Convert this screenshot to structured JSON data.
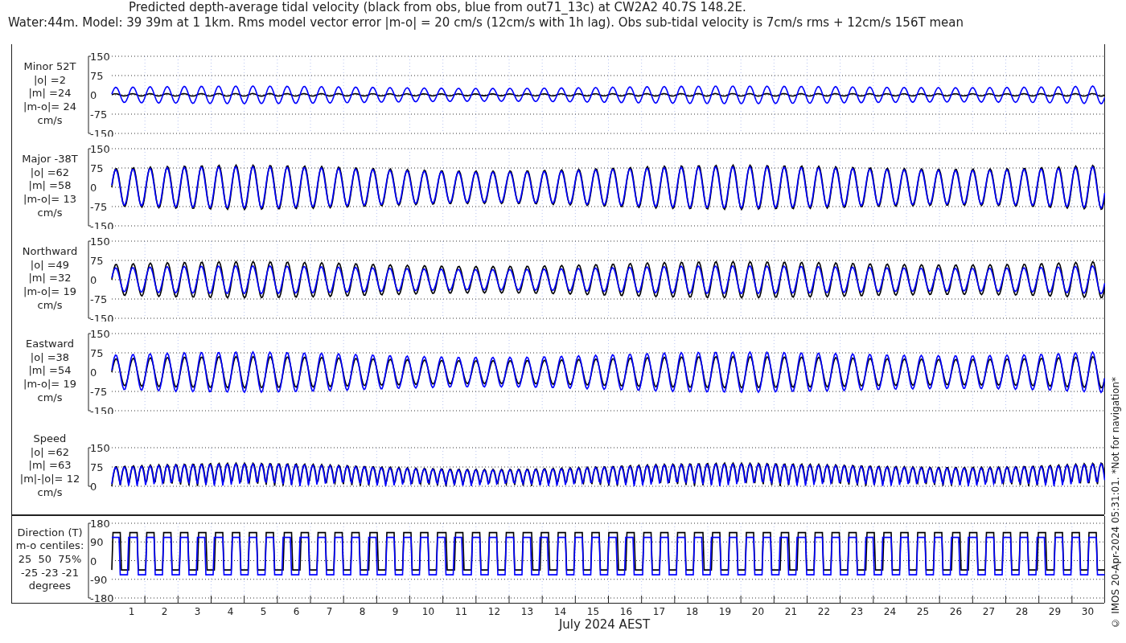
{
  "title": [
    "Predicted depth-average tidal velocity (black from obs, blue from out71_13c) at CW2A2 40.7S 148.2E.",
    "Water:44m. Model: 39 39m at 1 1km. Rms model vector error |m-o| = 20 cm/s (12cm/s with 1h lag). Obs sub-tidal velocity is 7cm/s rms + 12cm/s 156T mean"
  ],
  "panels": [
    {
      "kind": "velocity",
      "label": [
        "Minor 52T",
        "|o| =2",
        "|m| =24",
        "|m-o|= 24",
        "cm/s"
      ],
      "yticks": [
        "150",
        "75",
        "0",
        "-75",
        "-150"
      ]
    },
    {
      "kind": "velocity",
      "label": [
        "Major -38T",
        "|o| =62",
        "|m| =58",
        "|m-o|= 13",
        "cm/s"
      ],
      "yticks": [
        "150",
        "75",
        "0",
        "-75",
        "-150"
      ]
    },
    {
      "kind": "velocity",
      "label": [
        "Northward",
        "|o| =49",
        "|m| =32",
        "|m-o|= 19",
        "cm/s"
      ],
      "yticks": [
        "150",
        "75",
        "0",
        "-75",
        "-150"
      ]
    },
    {
      "kind": "velocity",
      "label": [
        "Eastward",
        "|o| =38",
        "|m| =54",
        "|m-o|= 19",
        "cm/s"
      ],
      "yticks": [
        "150",
        "75",
        "0",
        "-75",
        "-150"
      ]
    },
    {
      "kind": "speed",
      "label": [
        "Speed",
        "|o| =62",
        "|m| =63",
        "|m|-|o|= 12",
        "cm/s"
      ],
      "yticks": [
        "150",
        "75",
        "0"
      ]
    },
    {
      "kind": "direction",
      "label": [
        "Direction (T)",
        "m-o centiles:",
        "25  50  75%",
        "-25 -23 -21",
        "degrees"
      ],
      "yticks": [
        "180",
        "90",
        "0",
        "-90",
        "-180"
      ]
    }
  ],
  "xaxis": {
    "days": [
      "1",
      "2",
      "3",
      "4",
      "5",
      "6",
      "7",
      "8",
      "9",
      "10",
      "11",
      "12",
      "13",
      "14",
      "15",
      "16",
      "17",
      "18",
      "19",
      "20",
      "21",
      "22",
      "23",
      "24",
      "25",
      "26",
      "27",
      "28",
      "29",
      "30"
    ],
    "label": "July 2024 AEST"
  },
  "credit": "© IMOS 20-Apr-2024 05:31:01. *Not for navigation*"
}
